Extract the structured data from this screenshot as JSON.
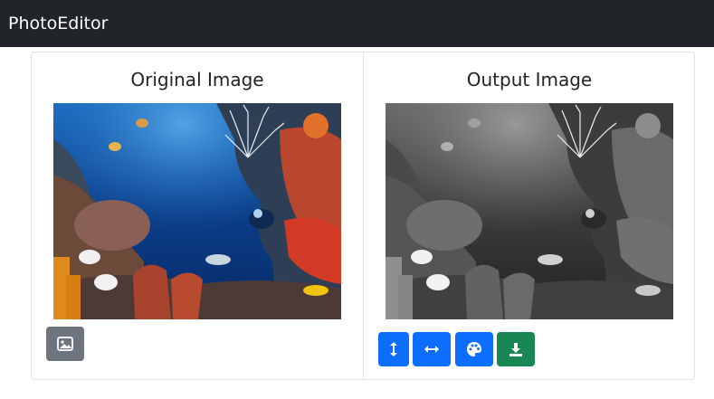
{
  "navbar": {
    "brand": "PhotoEditor"
  },
  "panels": {
    "original": {
      "title": "Original Image",
      "image_alt": "Coral reef underwater scene",
      "upload_icon": "image-icon"
    },
    "output": {
      "title": "Output Image",
      "image_alt": "Coral reef underwater scene in grayscale",
      "buttons": [
        {
          "icon": "flip-vertical-icon"
        },
        {
          "icon": "flip-horizontal-icon"
        },
        {
          "icon": "palette-icon"
        },
        {
          "icon": "download-icon"
        }
      ]
    }
  },
  "colors": {
    "navbar": "#212529",
    "secondary": "#6c757d",
    "primary": "#0d6efd",
    "success": "#198754"
  }
}
